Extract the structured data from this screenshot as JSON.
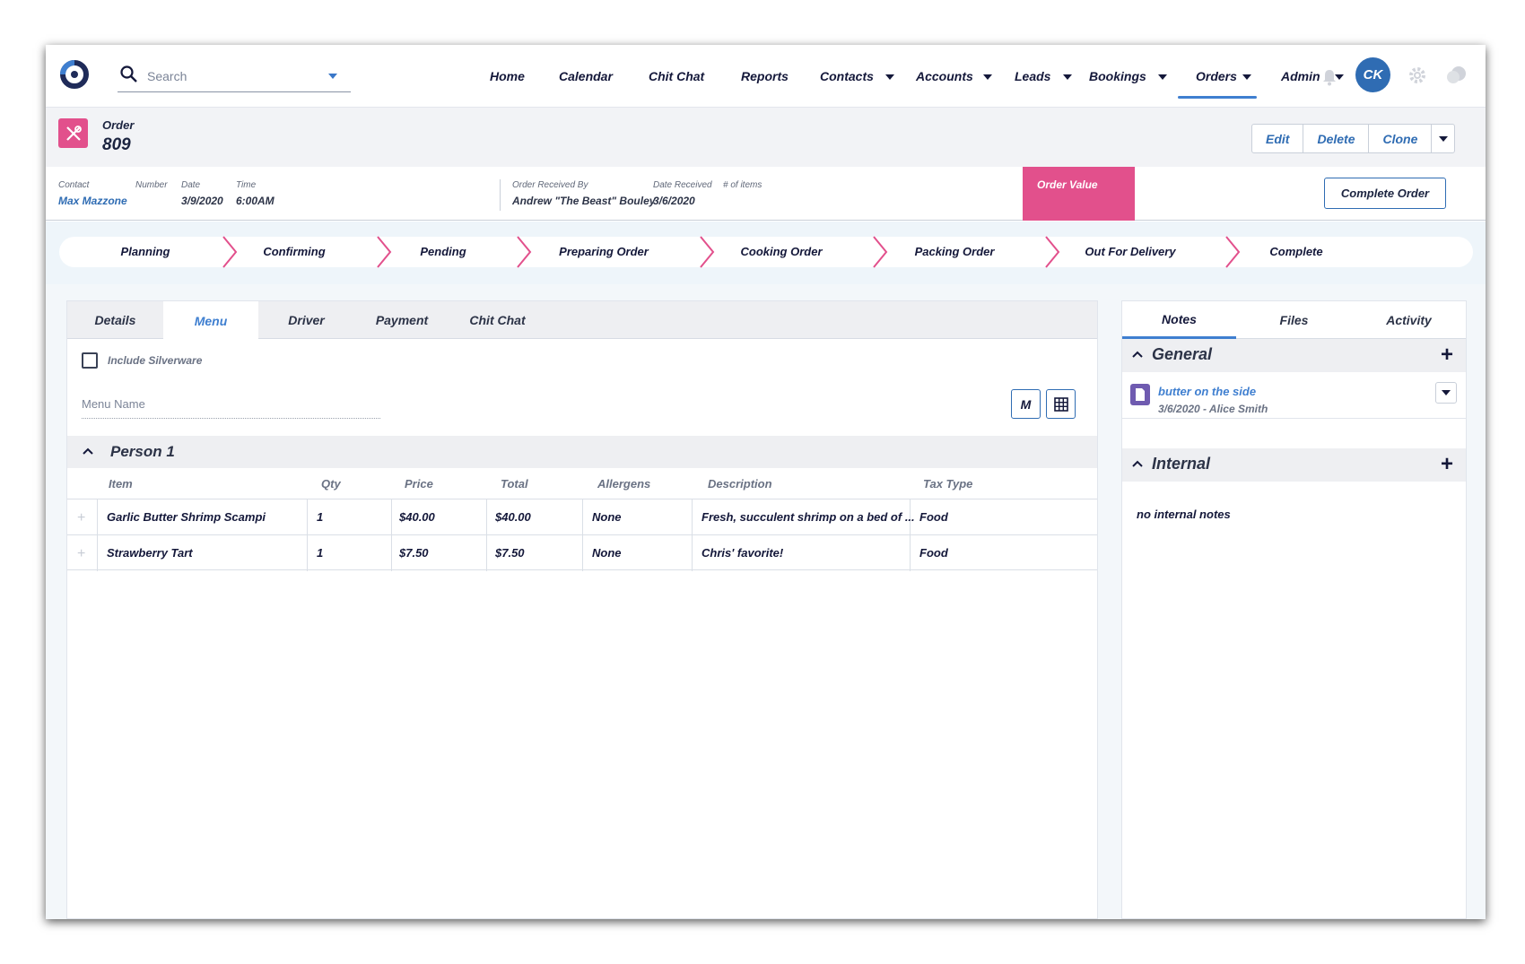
{
  "search": {
    "placeholder": "Search"
  },
  "nav": {
    "home": "Home",
    "calendar": "Calendar",
    "chitchat": "Chit Chat",
    "reports": "Reports",
    "contacts": "Contacts",
    "accounts": "Accounts",
    "leads": "Leads",
    "bookings": "Bookings",
    "orders": "Orders",
    "admin": "Admin"
  },
  "user": {
    "initials": "CK"
  },
  "order": {
    "label": "Order",
    "number": "809",
    "actions": {
      "edit": "Edit",
      "delete": "Delete",
      "clone": "Clone"
    },
    "info": {
      "contact_label": "Contact",
      "contact_value": "Max Mazzone",
      "number_label": "Number",
      "date_label": "Date",
      "date_value": "3/9/2020",
      "time_label": "Time",
      "time_value": "6:00AM",
      "received_by_label": "Order Received By",
      "received_by_value": "Andrew \"The Beast\" Bouley",
      "date_received_label": "Date Received",
      "date_received_value": "3/6/2020",
      "items_label": "# of items",
      "order_value_label": "Order Value"
    },
    "complete_label": "Complete Order"
  },
  "pipeline": [
    "Planning",
    "Confirming",
    "Pending",
    "Preparing Order",
    "Cooking Order",
    "Packing Order",
    "Out For Delivery",
    "Complete"
  ],
  "tabs": [
    "Details",
    "Menu",
    "Driver",
    "Payment",
    "Chit Chat"
  ],
  "menu": {
    "silverware_label": "Include Silverware",
    "menu_name_placeholder": "Menu Name",
    "m_button": "M",
    "person": "Person 1",
    "columns": [
      "Item",
      "Qty",
      "Price",
      "Total",
      "Allergens",
      "Description",
      "Tax Type"
    ],
    "rows": [
      {
        "item": "Garlic Butter Shrimp Scampi",
        "qty": "1",
        "price": "$40.00",
        "total": "$40.00",
        "allergens": "None",
        "description": "Fresh, succulent shrimp on a bed of ...",
        "tax": "Food"
      },
      {
        "item": "Strawberry Tart",
        "qty": "1",
        "price": "$7.50",
        "total": "$7.50",
        "allergens": "None",
        "description": "Chris' favorite!",
        "tax": "Food"
      }
    ]
  },
  "right_tabs": [
    "Notes",
    "Files",
    "Activity"
  ],
  "notes": {
    "general_title": "General",
    "note": {
      "title": "butter on the side",
      "meta": "3/6/2020 - Alice Smith"
    },
    "internal_title": "Internal",
    "internal_empty": "no internal notes"
  },
  "colors": {
    "accent": "#e2508c",
    "primary": "#2f6cb3",
    "link": "#3f7fd0"
  }
}
